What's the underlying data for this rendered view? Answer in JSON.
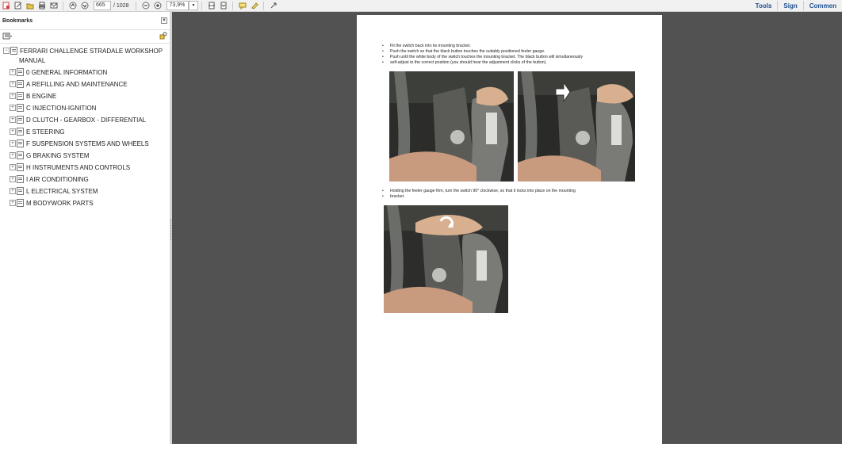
{
  "toolbar": {
    "page_current": "665",
    "page_total": "/ 1028",
    "zoom": "73,9%",
    "tools_label": "Tools",
    "sign_label": "Sign",
    "comment_label": "Commen"
  },
  "sidebar": {
    "title": "Bookmarks",
    "items": [
      {
        "label": "FERRARI CHALLENGE STRADALE WORKSHOP",
        "expander": "−"
      },
      {
        "label": "MANUAL",
        "expander": ""
      },
      {
        "label": "0 GENERAL INFORMATION",
        "expander": "+"
      },
      {
        "label": "A REFILLING AND MAINTENANCE",
        "expander": "+"
      },
      {
        "label": "B ENGINE",
        "expander": "+"
      },
      {
        "label": "C INJECTION-IGNITION",
        "expander": "+"
      },
      {
        "label": "D CLUTCH - GEARBOX - DIFFERENTIAL",
        "expander": "+"
      },
      {
        "label": "E STEERING",
        "expander": "+"
      },
      {
        "label": "F SUSPENSION SYSTEMS AND WHEELS",
        "expander": "+"
      },
      {
        "label": "G BRAKING SYSTEM",
        "expander": "+"
      },
      {
        "label": "H INSTRUMENTS AND CONTROLS",
        "expander": "+"
      },
      {
        "label": "I AIR CONDITIONING",
        "expander": "+"
      },
      {
        "label": "L ELECTRICAL SYSTEM",
        "expander": "+"
      },
      {
        "label": "M BODYWORK PARTS",
        "expander": "+"
      }
    ]
  },
  "document": {
    "bullets_1": [
      "Fit the switch back into its mounting bracket.",
      "Push the switch so that the black button touches the suitably positioned feeler gauge.",
      "Push until the white body of the switch touches the mounting bracket. The black button will simultaneously",
      "self-adjust to the correct position (you should hear the adjustment clicks of the button)."
    ],
    "bullets_2": [
      "Holding the feeler gauge firm, turn the switch 90° clockwise, so that it locks into place on the mounting",
      "bracket."
    ]
  }
}
